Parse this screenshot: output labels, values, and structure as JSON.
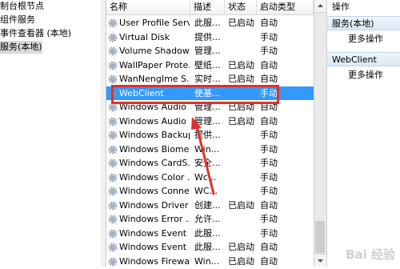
{
  "tree": {
    "items": [
      {
        "label": "制台根节点",
        "selected": false
      },
      {
        "label": "组件服务",
        "selected": false
      },
      {
        "label": "事件查看器 (本地)",
        "selected": false
      },
      {
        "label": "服务(本地)",
        "selected": true
      }
    ]
  },
  "list": {
    "columns": [
      "名称",
      "描述",
      "状态",
      "启动类型"
    ],
    "rows": [
      {
        "name": "User Profile Serv...",
        "desc": "此服...",
        "status": "已启动",
        "startup": "自动"
      },
      {
        "name": "Virtual Disk",
        "desc": "提供...",
        "status": "",
        "startup": "手动"
      },
      {
        "name": "Volume Shadow...",
        "desc": "管理...",
        "status": "",
        "startup": "手动"
      },
      {
        "name": "WallPaper Prote...",
        "desc": "壁纸...",
        "status": "已启动",
        "startup": "自动"
      },
      {
        "name": "WanNengIme S...",
        "desc": "实时...",
        "status": "已启动",
        "startup": "自动"
      },
      {
        "name": "WebClient",
        "desc": "使基...",
        "status": "",
        "startup": "手动"
      },
      {
        "name": "Windows Audio",
        "desc": "管理...",
        "status": "已启动",
        "startup": "自动"
      },
      {
        "name": "Windows Audio ...",
        "desc": "管理...",
        "status": "已启动",
        "startup": "自动"
      },
      {
        "name": "Windows Backup",
        "desc": "提供...",
        "status": "",
        "startup": "手动"
      },
      {
        "name": "Windows Biome...",
        "desc": "Win...",
        "status": "",
        "startup": "手动"
      },
      {
        "name": "Windows CardS...",
        "desc": "安全...",
        "status": "",
        "startup": "手动"
      },
      {
        "name": "Windows Color ...",
        "desc": "Wc...",
        "status": "",
        "startup": "手动"
      },
      {
        "name": "Windows Conne...",
        "desc": "WC...",
        "status": "",
        "startup": "手动"
      },
      {
        "name": "Windows Driver ...",
        "desc": "创建...",
        "status": "已启动",
        "startup": "自动"
      },
      {
        "name": "Windows Error ...",
        "desc": "允许...",
        "status": "",
        "startup": "手动"
      },
      {
        "name": "Windows Event ...",
        "desc": "此服...",
        "status": "",
        "startup": "手动"
      },
      {
        "name": "Windows Event ...",
        "desc": "此服...",
        "status": "已启动",
        "startup": "自动"
      },
      {
        "name": "Windows Firewall",
        "desc": "Win...",
        "status": "已启动",
        "startup": "自动"
      }
    ],
    "selected_row": "WebClient"
  },
  "actions": {
    "title": "操作",
    "groups": [
      {
        "title": "服务(本地)",
        "items": [
          "更多操作"
        ]
      },
      {
        "title": "WebClient",
        "items": [
          "更多操作"
        ]
      }
    ]
  },
  "icons": {
    "service": "gear-icon",
    "expand": "triangle-right-icon"
  },
  "colors": {
    "selection_bg": "#3399ff",
    "annotation_red": "#e0302a"
  },
  "watermark": "Bai 经验"
}
